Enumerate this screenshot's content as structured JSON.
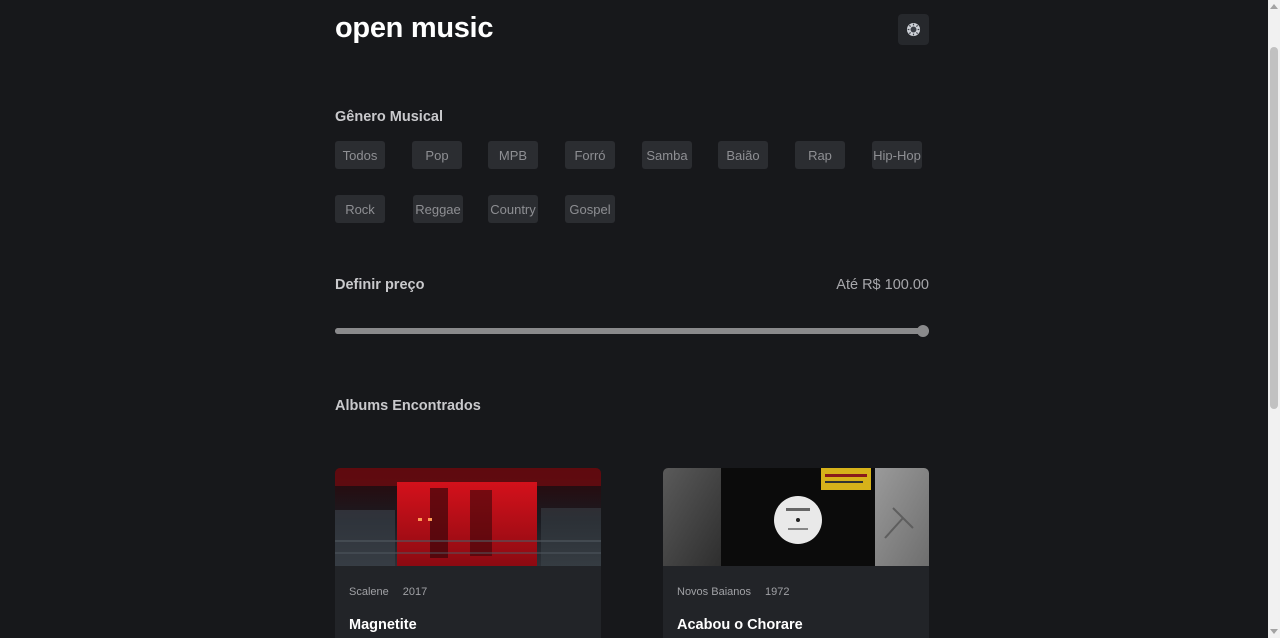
{
  "header": {
    "app_title": "open music"
  },
  "genres": {
    "title": "Gênero Musical",
    "items": [
      "Todos",
      "Pop",
      "MPB",
      "Forró",
      "Samba",
      "Baião",
      "Rap",
      "Hip-Hop",
      "Rock",
      "Reggae",
      "Country",
      "Gospel"
    ]
  },
  "price": {
    "title": "Definir preço",
    "value_label": "Até R$ 100.00",
    "slider_fraction": 1.0
  },
  "albums": {
    "title": "Albums Encontrados",
    "items": [
      {
        "artist": "Scalene",
        "year": "2017",
        "title": "Magnetite"
      },
      {
        "artist": "Novos Baianos",
        "year": "1972",
        "title": "Acabou o Chorare"
      }
    ]
  },
  "colors": {
    "background": "#17181b",
    "chip": "#2b2d31",
    "card": "#222428",
    "slider": "#8a8a8c"
  }
}
